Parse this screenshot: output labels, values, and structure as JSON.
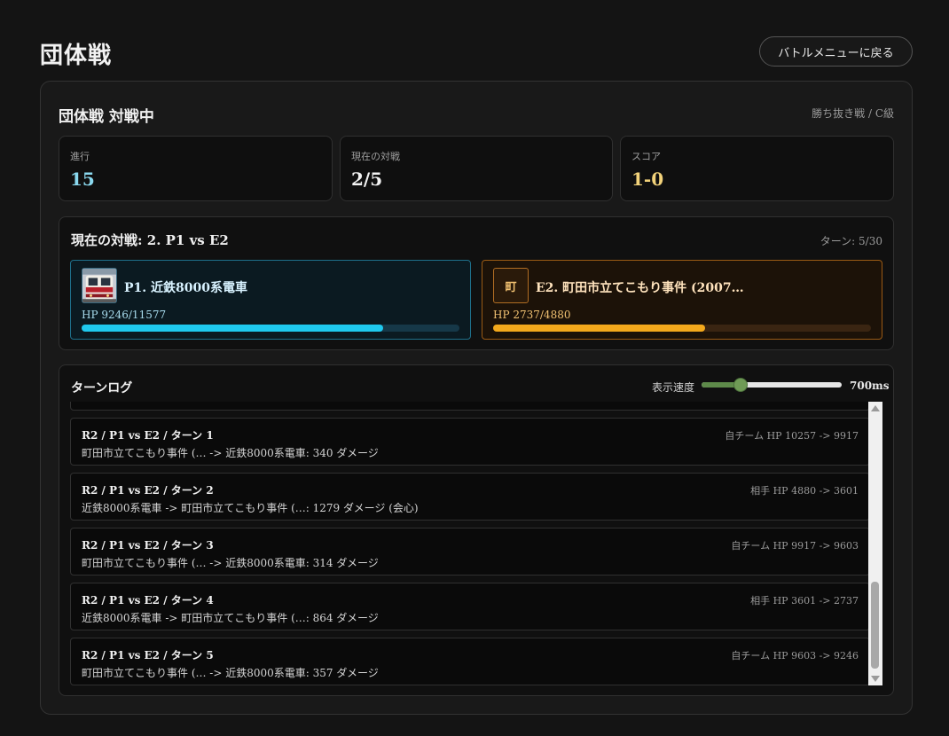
{
  "page": {
    "title": "団体戦",
    "back_button": "バトルメニューに戻る"
  },
  "card": {
    "title": "団体戦 対戦中",
    "meta": "勝ち抜き戦 / C級"
  },
  "stats": [
    {
      "label": "進行",
      "value": "15",
      "color": "#8ad8ee"
    },
    {
      "label": "現在の対戦",
      "value": "2/5",
      "color": "#f2f2f2"
    },
    {
      "label": "スコア",
      "value": "1-0",
      "color": "#f2d27a"
    }
  ],
  "match": {
    "title": "現在の対戦: 2. P1 vs E2",
    "turn": "ターン: 5/30",
    "player": {
      "name": "P1. 近鉄8000系電車",
      "hp_text": "HP 9246/11577",
      "hp_ratio": 0.799,
      "icon": "train-icon"
    },
    "enemy": {
      "name": "E2. 町田市立てこもり事件 (2007…",
      "hp_text": "HP 2737/4880",
      "hp_ratio": 0.561,
      "avatar_char": "町"
    }
  },
  "log": {
    "title": "ターンログ",
    "speed_label": "表示速度",
    "speed_value": "700ms",
    "speed_ratio": 0.28,
    "entries": [
      {
        "head": "R2 / P1 vs E2 / ターン 1",
        "hp": "自チーム HP 10257 -> 9917",
        "body": "町田市立てこもり事件 (… -> 近鉄8000系電車: 340 ダメージ"
      },
      {
        "head": "R2 / P1 vs E2 / ターン 2",
        "hp": "相手 HP 4880 -> 3601",
        "body": "近鉄8000系電車 -> 町田市立てこもり事件 (…: 1279 ダメージ (会心)"
      },
      {
        "head": "R2 / P1 vs E2 / ターン 3",
        "hp": "自チーム HP 9917 -> 9603",
        "body": "町田市立てこもり事件 (… -> 近鉄8000系電車: 314 ダメージ"
      },
      {
        "head": "R2 / P1 vs E2 / ターン 4",
        "hp": "相手 HP 3601 -> 2737",
        "body": "近鉄8000系電車 -> 町田市立てこもり事件 (…: 864 ダメージ"
      },
      {
        "head": "R2 / P1 vs E2 / ターン 5",
        "hp": "自チーム HP 9603 -> 9246",
        "body": "町田市立てこもり事件 (… -> 近鉄8000系電車: 357 ダメージ"
      }
    ]
  }
}
